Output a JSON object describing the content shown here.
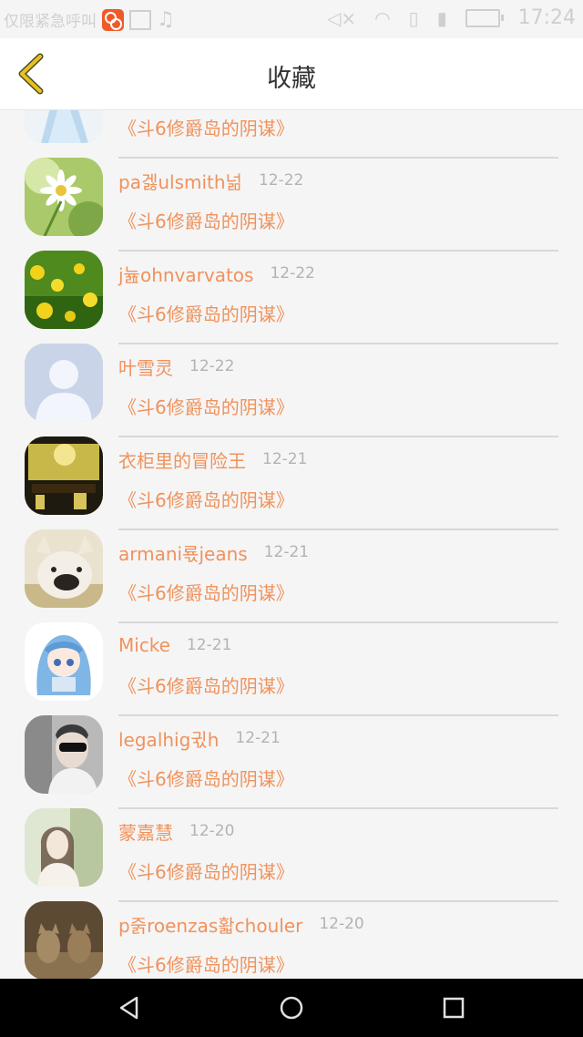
{
  "status_bar": {
    "carrier_text": "仅限紧急呼叫",
    "time": "17:24"
  },
  "header": {
    "title": "收藏",
    "back_icon": "chevron-left-icon"
  },
  "items": [
    {
      "name": "",
      "date": "",
      "book": "《斗6修爵岛的阴谋》",
      "avatar": "tulle-dress"
    },
    {
      "name": "pa겛ulsmith넒",
      "date": "12-22",
      "book": "《斗6修爵岛的阴谋》",
      "avatar": "daisy"
    },
    {
      "name": "j늂ohnvarvatos",
      "date": "12-22",
      "book": "《斗6修爵岛的阴谋》",
      "avatar": "dandelion-field"
    },
    {
      "name": "叶雪灵",
      "date": "12-22",
      "book": "《斗6修爵岛的阴谋》",
      "avatar": "default-person"
    },
    {
      "name": "衣柜里的冒险王",
      "date": "12-21",
      "book": "《斗6修爵岛的阴谋》",
      "avatar": "cafe-interior"
    },
    {
      "name": "armani룏jeans",
      "date": "12-21",
      "book": "《斗6修爵岛的阴谋》",
      "avatar": "bulldog"
    },
    {
      "name": "Micke",
      "date": "12-21",
      "book": "《斗6修爵岛的阴谋》",
      "avatar": "anime-girl"
    },
    {
      "name": "legalhig귃h",
      "date": "12-21",
      "book": "《斗6修爵岛的阴谋》",
      "avatar": "man-sunglasses"
    },
    {
      "name": "蒙嘉慧",
      "date": "12-20",
      "book": "《斗6修爵岛的阴谋》",
      "avatar": "girl-garden"
    },
    {
      "name": "p줅roenzas홟chouler",
      "date": "12-20",
      "book": "《斗6修爵岛的阴谋》",
      "avatar": "cats"
    }
  ],
  "system_nav": {
    "back": "triangle-back-icon",
    "home": "circle-home-icon",
    "recents": "square-recents-icon"
  },
  "colors": {
    "accent": "#f0925c",
    "date": "#b3b3b3",
    "back_arrow": "#e8c020"
  }
}
